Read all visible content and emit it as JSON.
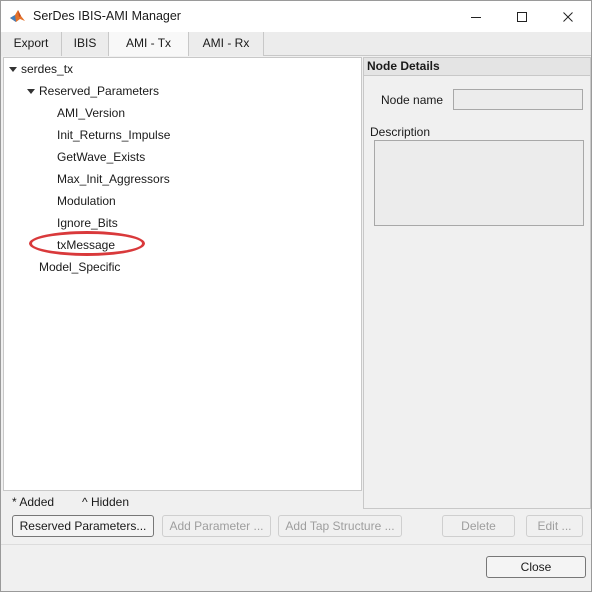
{
  "window": {
    "title": "SerDes IBIS-AMI Manager",
    "app_icon": "matlab-icon"
  },
  "tabs": [
    {
      "label": "Export",
      "active": false
    },
    {
      "label": "IBIS",
      "active": false
    },
    {
      "label": "AMI - Tx",
      "active": true
    },
    {
      "label": "AMI - Rx",
      "active": false
    }
  ],
  "tree": {
    "root": {
      "label": "serdes_tx",
      "expanded": true
    },
    "reserved": {
      "label": "Reserved_Parameters",
      "expanded": true
    },
    "children": [
      {
        "label": "AMI_Version"
      },
      {
        "label": "Init_Returns_Impulse"
      },
      {
        "label": "GetWave_Exists"
      },
      {
        "label": "Max_Init_Aggressors"
      },
      {
        "label": "Modulation"
      },
      {
        "label": "Ignore_Bits"
      },
      {
        "label": "txMessage",
        "highlighted": true
      }
    ],
    "model_specific": {
      "label": "Model_Specific"
    }
  },
  "node_details": {
    "header": "Node Details",
    "node_name_label": "Node name",
    "node_name_value": "",
    "description_label": "Description",
    "description_value": ""
  },
  "legend": {
    "added": "* Added",
    "hidden": "^ Hidden"
  },
  "buttons": {
    "reserved_parameters": "Reserved Parameters...",
    "add_parameter": "Add Parameter ...",
    "add_tap_structure": "Add Tap Structure ...",
    "delete": "Delete",
    "edit": "Edit ...",
    "close": "Close"
  },
  "colors": {
    "highlight_ellipse": "#d9393b",
    "window_bg": "#f0f0f0"
  }
}
